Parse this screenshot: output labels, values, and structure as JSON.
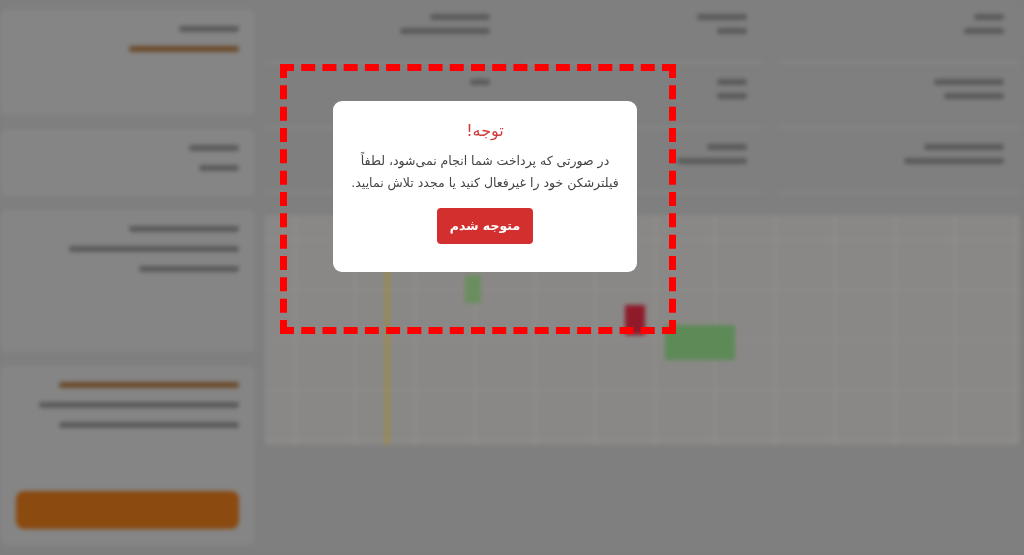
{
  "dialog": {
    "title": "توجه!",
    "message": "در صورتی که پرداخت شما انجام نمی‌شود، لطفاً فیلترشکن خود را غیرفعال کنید یا مجدد تلاش نمایید.",
    "button": "متوجه شدم"
  }
}
